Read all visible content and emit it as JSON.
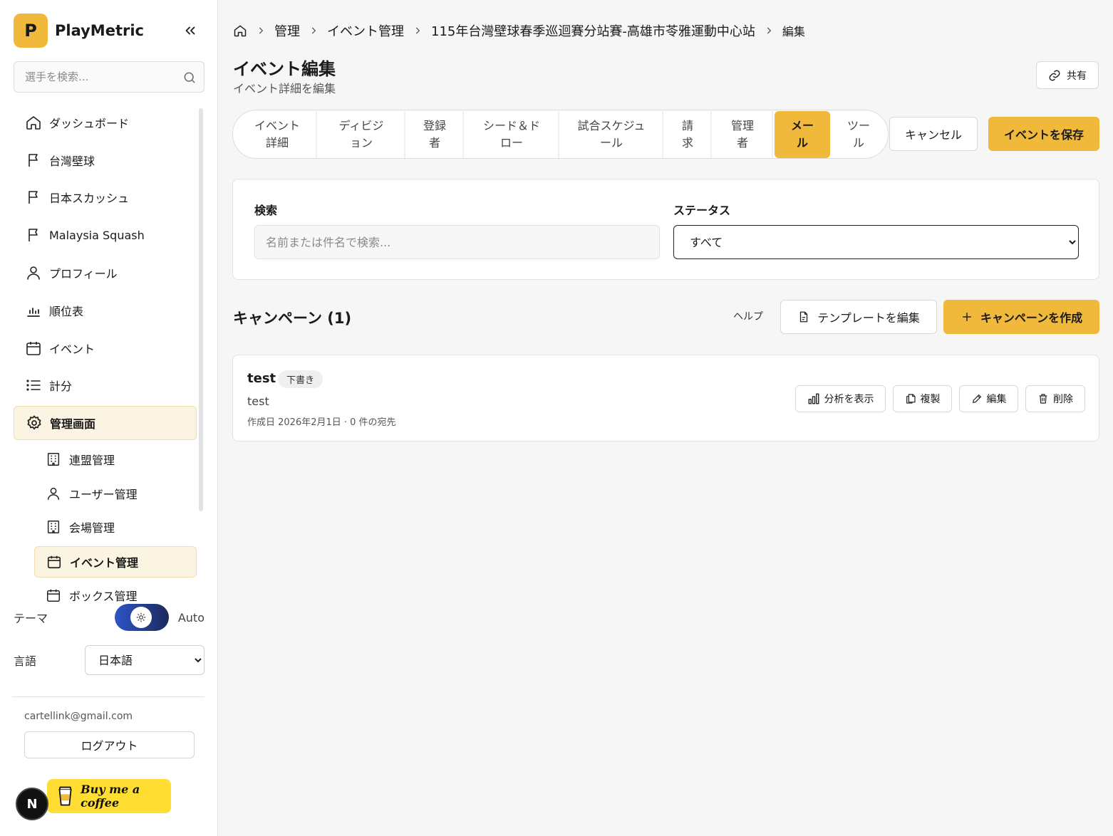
{
  "sidebar": {
    "brand_initial": "P",
    "brand_name": "PlayMetric",
    "search_placeholder": "選手を検索...",
    "items": [
      {
        "label": "ダッシュボード",
        "icon": "home-icon"
      },
      {
        "label": "台灣壁球",
        "icon": "flag-icon"
      },
      {
        "label": "日本スカッシュ",
        "icon": "flag-icon"
      },
      {
        "label": "Malaysia Squash",
        "icon": "flag-icon"
      },
      {
        "label": "プロフィール",
        "icon": "user-icon"
      },
      {
        "label": "順位表",
        "icon": "bar-chart-icon"
      },
      {
        "label": "イベント",
        "icon": "calendar-icon"
      },
      {
        "label": "計分",
        "icon": "list-icon"
      },
      {
        "label": "管理画面",
        "icon": "gear-icon",
        "active": true
      }
    ],
    "sub_items": [
      {
        "label": "連盟管理",
        "icon": "building-icon"
      },
      {
        "label": "ユーザー管理",
        "icon": "user-icon"
      },
      {
        "label": "会場管理",
        "icon": "building-icon"
      },
      {
        "label": "イベント管理",
        "icon": "calendar-icon",
        "active": true
      },
      {
        "label": "ボックス管理",
        "icon": "calendar-icon"
      }
    ],
    "theme_label": "テーマ",
    "theme_mode": "Auto",
    "lang_label": "言語",
    "lang_value": "日本語",
    "email": "cartellink@gmail.com",
    "logout_label": "ログアウト",
    "next_badge": "N",
    "coffee_label": "Buy me a coffee"
  },
  "breadcrumb": [
    "管理",
    "イベント管理",
    "115年台灣壁球春季巡迴賽分站賽-高雄市苓雅運動中心站",
    "編集"
  ],
  "header": {
    "title": "イベント編集",
    "subtitle": "イベント詳細を編集",
    "share_label": "共有"
  },
  "tabs": [
    {
      "line1": "イベント",
      "line2": "詳細"
    },
    {
      "line1": "ディビジ",
      "line2": "ョン"
    },
    {
      "line1": "登録",
      "line2": "者"
    },
    {
      "line1": "シード＆ド",
      "line2": "ロー"
    },
    {
      "line1": "試合スケジュ",
      "line2": "ール"
    },
    {
      "line1": "請",
      "line2": "求"
    },
    {
      "line1": "管理",
      "line2": "者"
    },
    {
      "line1": "メー",
      "line2": "ル",
      "active": true
    },
    {
      "line1": "ツー",
      "line2": "ル"
    }
  ],
  "actions": {
    "cancel_label": "キャンセル",
    "save_label": "イベントを保存"
  },
  "filters": {
    "search_label": "検索",
    "search_placeholder": "名前または件名で検索...",
    "status_label": "ステータス",
    "status_value": "すべて"
  },
  "campaigns": {
    "title": "キャンペーン (1)",
    "help_label": "ヘルプ",
    "edit_template_label": "テンプレートを編集",
    "create_label": "キャンペーンを作成",
    "items": [
      {
        "name": "test",
        "status": "下書き",
        "description": "test",
        "meta": "作成日 2026年2月1日 · 0 件の宛先",
        "analytics_label": "分析を表示",
        "duplicate_label": "複製",
        "edit_label": "編集",
        "delete_label": "削除"
      }
    ]
  },
  "colors": {
    "accent": "#f0b93b",
    "active_bg": "#fcf4e2",
    "coffee": "#ffdd33"
  }
}
